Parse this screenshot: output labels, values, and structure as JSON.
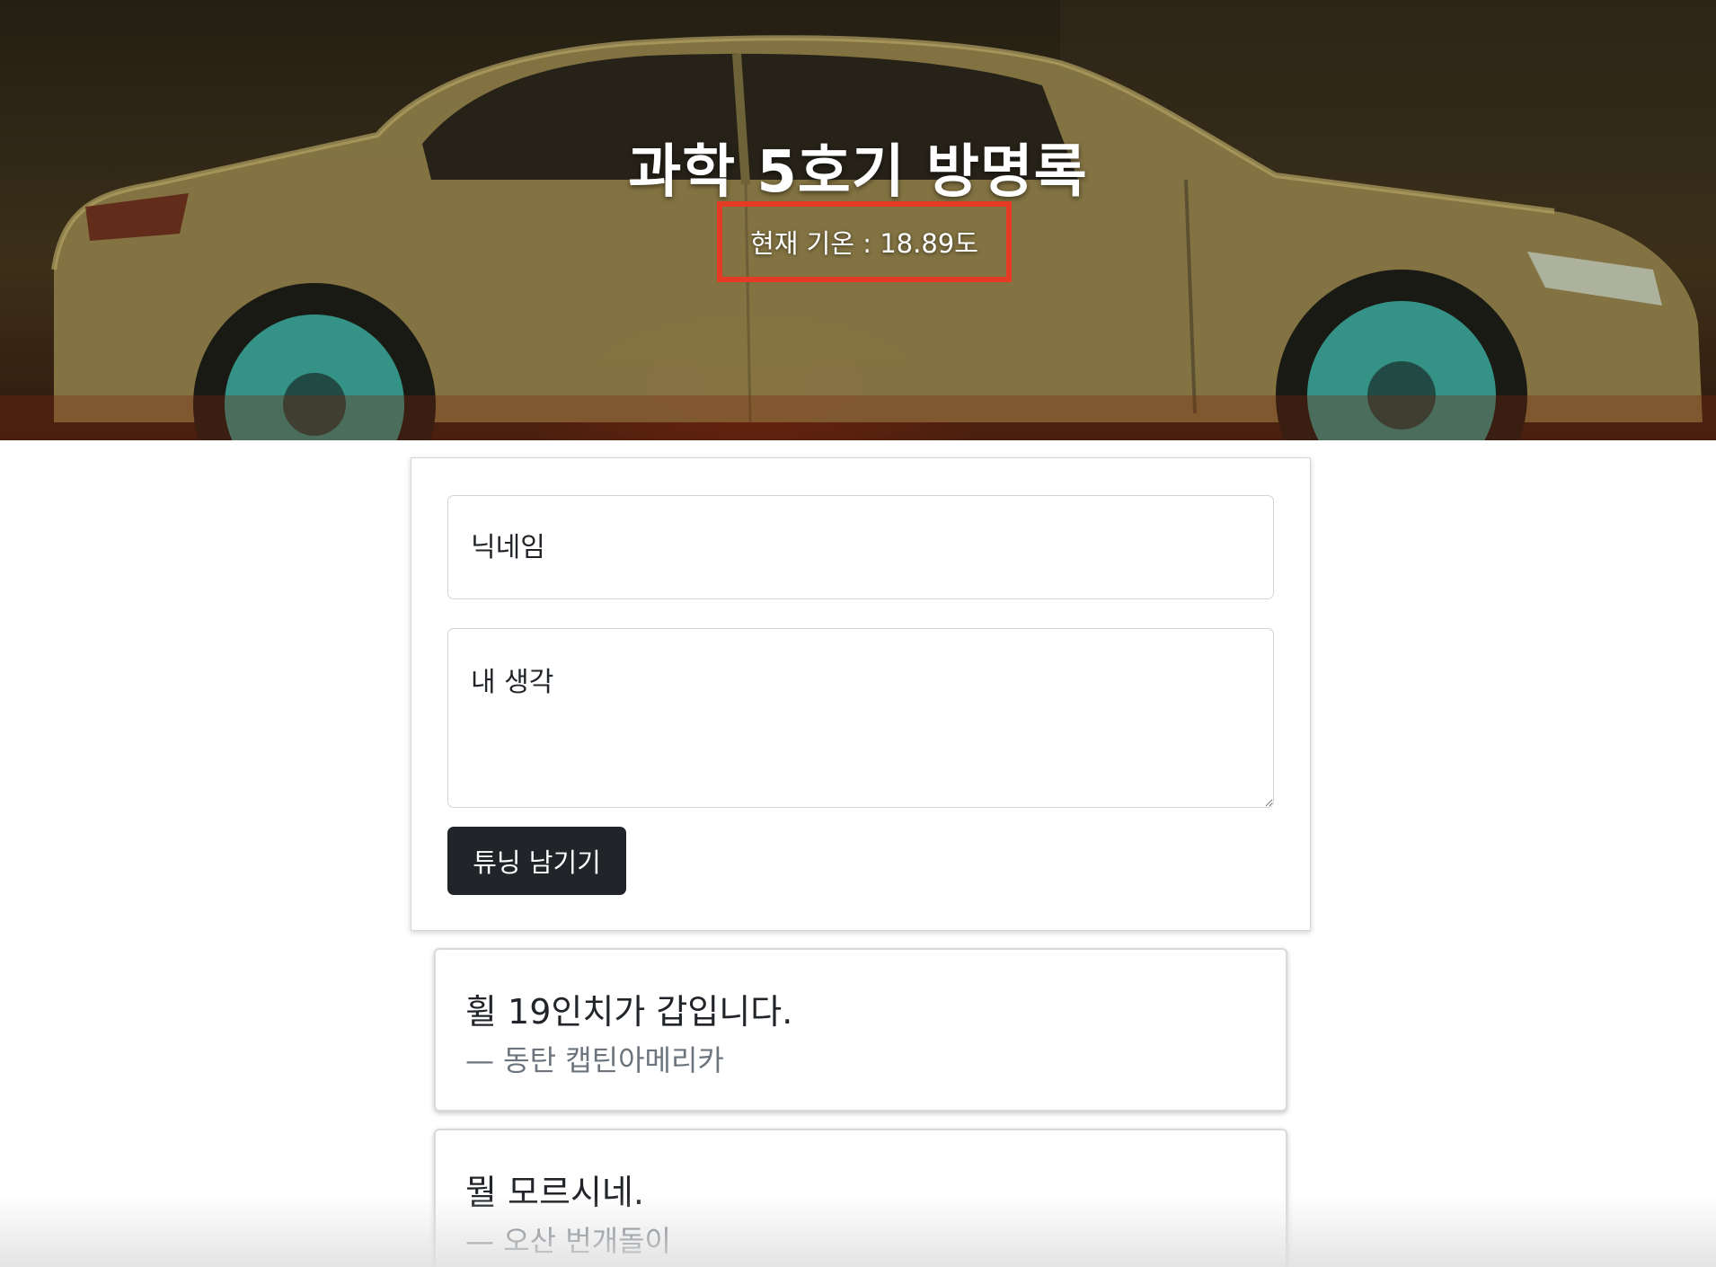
{
  "header": {
    "title": "과학 5호기 방명록",
    "weather": "현재 기온 : 18.89도"
  },
  "form": {
    "nickname_placeholder": "닉네임",
    "thought_placeholder": "내 생각",
    "submit_label": "튜닝 남기기"
  },
  "entries": [
    {
      "message": "휠 19인치가 갑입니다.",
      "author": "— 동탄 캡틴아메리카"
    },
    {
      "message": "뭘 모르시네.",
      "author": "— 오산 번개돌이"
    }
  ],
  "colors": {
    "highlight_border": "#e53a23",
    "button_bg": "#212529",
    "author_text": "#6c757d"
  }
}
